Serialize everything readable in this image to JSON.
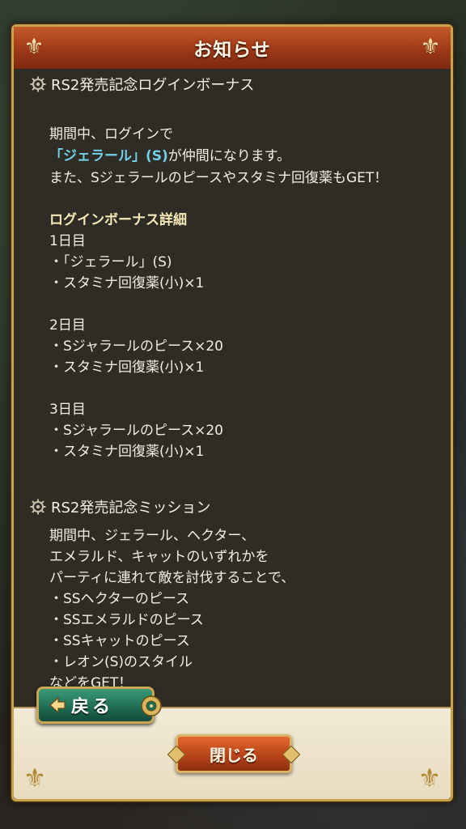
{
  "dialog": {
    "title": "お知らせ"
  },
  "sections": [
    {
      "heading": "RS2発売記念ログインボーナス",
      "lines": {
        "l1": "期間中、ログインで",
        "l2_highlight": "「ジェラール」(S)",
        "l2_rest": "が仲間になります。",
        "l3": "また、Sジェラールのピースやスタミナ回復薬もGET！",
        "detail_title": "ログインボーナス詳細",
        "d1": "1日目",
        "d1a": "・「ジェラール」(S)",
        "d1b": "・スタミナ回復薬(小)×1",
        "d2": "2日目",
        "d2a": "・Sジャラールのピース×20",
        "d2b": "・スタミナ回復薬(小)×1",
        "d3": "3日目",
        "d3a": "・Sジャラールのピース×20",
        "d3b": "・スタミナ回復薬(小)×1"
      }
    },
    {
      "heading": "RS2発売記念ミッション",
      "lines": {
        "m1": "期間中、ジェラール、ヘクター、",
        "m2": "エメラルド、キャットのいずれかを",
        "m3": "パーティに連れて敵を討伐することで、",
        "m4": "・SSヘクターのピース",
        "m5": "・SSエメラルドのピース",
        "m6": "・SSキャットのピース",
        "m7": "・レオン(S)のスタイル",
        "m8": "などをGET！"
      }
    }
  ],
  "buttons": {
    "back": "戻る",
    "close": "閉じる"
  },
  "colors": {
    "highlight": "#6fd2e8",
    "title_bar": "#9e3816",
    "back_button": "#1f6a52",
    "close_button": "#b8441a",
    "frame_gold": "#c9a24e"
  },
  "icons": {
    "section": "gear-icon",
    "back": "arrow-left-icon",
    "corner": "fleur-ornament-icon"
  }
}
